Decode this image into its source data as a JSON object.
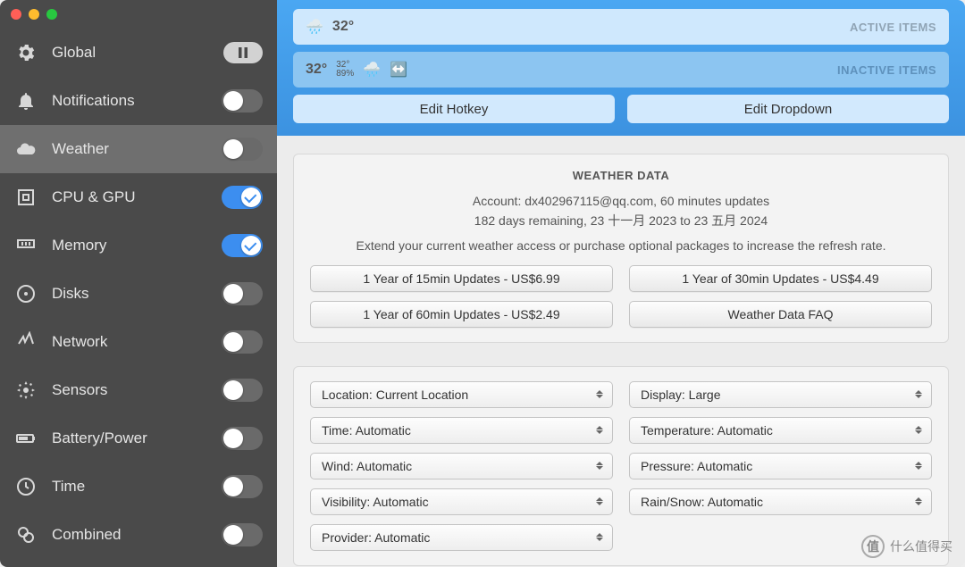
{
  "sidebar": {
    "items": [
      {
        "key": "global",
        "label": "Global",
        "ctrl": "pause"
      },
      {
        "key": "notifications",
        "label": "Notifications",
        "ctrl": "switch",
        "on": false
      },
      {
        "key": "weather",
        "label": "Weather",
        "ctrl": "switch",
        "on": false,
        "active": true
      },
      {
        "key": "cpu-gpu",
        "label": "CPU & GPU",
        "ctrl": "switch",
        "on": true
      },
      {
        "key": "memory",
        "label": "Memory",
        "ctrl": "switch",
        "on": true
      },
      {
        "key": "disks",
        "label": "Disks",
        "ctrl": "switch",
        "on": false
      },
      {
        "key": "network",
        "label": "Network",
        "ctrl": "switch",
        "on": false
      },
      {
        "key": "sensors",
        "label": "Sensors",
        "ctrl": "switch",
        "on": false
      },
      {
        "key": "battery",
        "label": "Battery/Power",
        "ctrl": "switch",
        "on": false
      },
      {
        "key": "time",
        "label": "Time",
        "ctrl": "switch",
        "on": false
      },
      {
        "key": "combined",
        "label": "Combined",
        "ctrl": "switch",
        "on": false
      }
    ]
  },
  "header": {
    "active_label": "ACTIVE ITEMS",
    "inactive_label": "INACTIVE ITEMS",
    "active_temp": "32°",
    "inactive_temp": "32°",
    "inactive_small_top": "32°",
    "inactive_small_bottom": "89%",
    "edit_hotkey": "Edit Hotkey",
    "edit_dropdown": "Edit Dropdown"
  },
  "weather_data": {
    "title": "WEATHER DATA",
    "account_line": "Account: dx402967115@qq.com, 60 minutes updates",
    "remaining_line": "182 days remaining, 23 十一月 2023 to 23 五月 2024",
    "sub": "Extend your current weather access or purchase optional packages to increase the refresh rate.",
    "buttons": [
      "1 Year of 15min Updates - US$6.99",
      "1 Year of 30min Updates - US$4.49",
      "1 Year of 60min Updates - US$2.49",
      "Weather Data FAQ"
    ]
  },
  "selects": [
    {
      "name": "location",
      "label": "Location: Current Location"
    },
    {
      "name": "display",
      "label": "Display: Large"
    },
    {
      "name": "time",
      "label": "Time: Automatic"
    },
    {
      "name": "temperature",
      "label": "Temperature: Automatic"
    },
    {
      "name": "wind",
      "label": "Wind: Automatic"
    },
    {
      "name": "pressure",
      "label": "Pressure: Automatic"
    },
    {
      "name": "visibility",
      "label": "Visibility: Automatic"
    },
    {
      "name": "rainsnow",
      "label": "Rain/Snow: Automatic"
    },
    {
      "name": "provider",
      "label": "Provider: Automatic"
    }
  ],
  "watermark": "什么值得买"
}
